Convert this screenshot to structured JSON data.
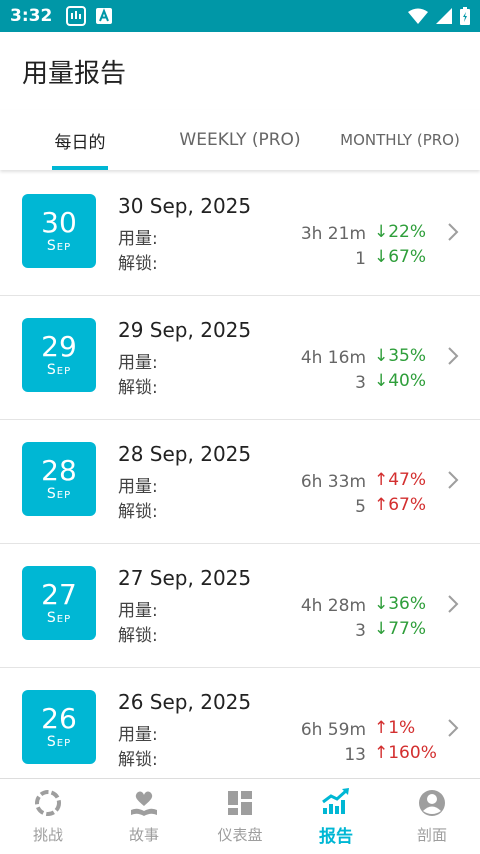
{
  "status": {
    "time": "3:32"
  },
  "header": {
    "title": "用量报告"
  },
  "tabs": [
    {
      "label": "每日的"
    },
    {
      "label": "WEEKLY (PRO)"
    },
    {
      "label": "MONTHLY (PRO)"
    }
  ],
  "labels": {
    "usage": "用量:",
    "unlock": "解锁:"
  },
  "rows": [
    {
      "day": "30",
      "month": "Sep",
      "date": "30 Sep, 2025",
      "usage": "3h 21m",
      "usage_delta": "↓22%",
      "unlocks": "1",
      "unlock_delta": "↓67%"
    },
    {
      "day": "29",
      "month": "Sep",
      "date": "29 Sep, 2025",
      "usage": "4h 16m",
      "usage_delta": "↓35%",
      "unlocks": "3",
      "unlock_delta": "↓40%"
    },
    {
      "day": "28",
      "month": "Sep",
      "date": "28 Sep, 2025",
      "usage": "6h 33m",
      "usage_delta": "↑47%",
      "unlocks": "5",
      "unlock_delta": "↑67%"
    },
    {
      "day": "27",
      "month": "Sep",
      "date": "27 Sep, 2025",
      "usage": "4h 28m",
      "usage_delta": "↓36%",
      "unlocks": "3",
      "unlock_delta": "↓77%"
    },
    {
      "day": "26",
      "month": "Sep",
      "date": "26 Sep, 2025",
      "usage": "6h 59m",
      "usage_delta": "↑1%",
      "unlocks": "13",
      "unlock_delta": "↑160%"
    }
  ],
  "nav": [
    {
      "label": "挑战",
      "icon": "challenge-ring-icon"
    },
    {
      "label": "故事",
      "icon": "heart-book-icon"
    },
    {
      "label": "仪表盘",
      "icon": "dashboard-grid-icon"
    },
    {
      "label": "报告",
      "icon": "report-chart-icon"
    },
    {
      "label": "剖面",
      "icon": "profile-icon"
    }
  ],
  "colors": {
    "status_bar": "#0097a7",
    "accent": "#00b7d4",
    "down": "#2e9e3a",
    "up": "#d32f2f"
  }
}
